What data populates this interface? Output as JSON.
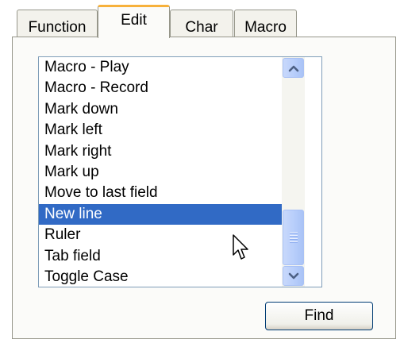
{
  "tabs": [
    {
      "label": "Function",
      "active": false
    },
    {
      "label": "Edit",
      "active": true
    },
    {
      "label": "Char",
      "active": false
    },
    {
      "label": "Macro",
      "active": false
    }
  ],
  "list": {
    "items": [
      "Macro - Play",
      "Macro - Record",
      "Mark down",
      "Mark left",
      "Mark right",
      "Mark up",
      "Move to last field",
      "New line",
      "Ruler",
      "Tab field",
      "Toggle Case"
    ],
    "selected_index": 7
  },
  "scrollbar": {
    "up_icon": "chevron-up-icon",
    "down_icon": "chevron-down-icon"
  },
  "find_button": {
    "label": "Find"
  },
  "colors": {
    "selection": "#316ac5",
    "active_tab_accent": "#f7b13b",
    "list_border": "#7f9db9"
  }
}
